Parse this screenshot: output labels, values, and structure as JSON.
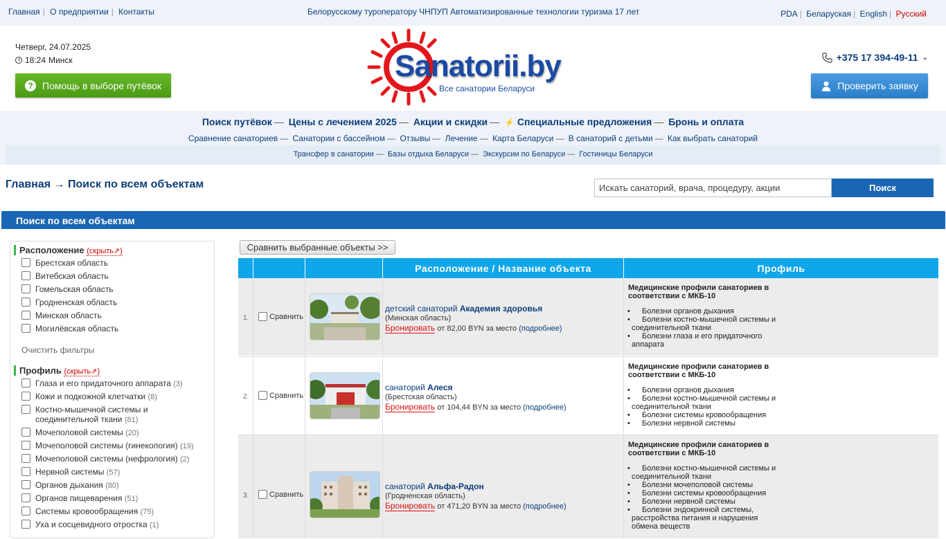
{
  "topbar": {
    "nav": [
      "Главная",
      "О предприятии",
      "Контакты"
    ],
    "tagline": "Белорусскому туроператору ЧНПУП Автоматизированные технологии туризма 17 лет",
    "langs": [
      "PDA",
      "Беларуская",
      "English",
      "Русский"
    ]
  },
  "header": {
    "date": "Четверг, 24.07.2025",
    "time": "18:24",
    "city": "Минск",
    "help_label": "Помощь в выборе путёвок",
    "logo_text": "Sanatorii.by",
    "logo_sub": "Все санатории Беларуси",
    "phone": "+375 17 394-49-11",
    "check_label": "Проверить заявку"
  },
  "menu": {
    "main": [
      "Поиск путёвок",
      "Цены с лечением 2025",
      "Акции и скидки",
      "Специальные предложения",
      "Бронь и оплата"
    ],
    "secondary": [
      "Сравнение санаториев",
      "Санатории с бассейном",
      "Отзывы",
      "Лечение",
      "Карта Беларуси",
      "В санаторий с детьми",
      "Как выбрать санаторий"
    ],
    "tertiary": [
      "Трансфер в санатории",
      "Базы отдыха Беларуси",
      "Экскурсии по Беларуси",
      "Гостиницы Беларуси"
    ]
  },
  "breadcrumb": {
    "home": "Главная",
    "arrow": "→",
    "current": "Поиск по всем объектам"
  },
  "search": {
    "placeholder": "Искать санаторий, врача, процедуру, акции",
    "button": "Поиск"
  },
  "section_title": "Поиск по всем объектам",
  "filters": {
    "location_title": "Расположение",
    "hide": "(скрыть",
    "regions": [
      "Брестская область",
      "Витебская область",
      "Гомельская область",
      "Гродненская область",
      "Минская область",
      "Могилёвская область"
    ],
    "clear": "Очистить фильтры",
    "profile_title": "Профиль",
    "profiles": [
      {
        "label": "Глаза и его придаточного аппарата",
        "count": "(3)"
      },
      {
        "label": "Кожи и подкожной клетчатки",
        "count": "(8)"
      },
      {
        "label": "Костно-мышечной системы и соединительной ткани",
        "count": "(81)"
      },
      {
        "label": "Мочеполовой системы",
        "count": "(20)"
      },
      {
        "label": "Мочеполовой системы (гинекология)",
        "count": "(19)"
      },
      {
        "label": "Мочеполовой системы (нефрология)",
        "count": "(2)"
      },
      {
        "label": "Нервной системы",
        "count": "(57)"
      },
      {
        "label": "Органов дыхания",
        "count": "(80)"
      },
      {
        "label": "Органов пищеварения",
        "count": "(51)"
      },
      {
        "label": "Системы кровообращения",
        "count": "(75)"
      },
      {
        "label": "Уха и сосцевидного отростка",
        "count": "(1)"
      }
    ]
  },
  "compare_button": "Сравнить выбранные объекты >>",
  "table": {
    "col_location": "Расположение / Название объекта",
    "col_profile": "Профиль",
    "compare": "Сравнить",
    "book": "Бронировать",
    "price_from": "от",
    "per_place": "за место",
    "more": "(подробнее)",
    "profile_heading": "Медицинские профили санаториев в соответствии с МКБ-10",
    "rows": [
      {
        "num": "1.",
        "type": "детский санаторий",
        "name": "Академия здоровья",
        "region": "(Минская область)",
        "price": "82,00",
        "currency": "BYN",
        "profiles": [
          "Болезни органов дыхания",
          "Болезни костно-мышечной системы и соединительной ткани",
          "Болезни глаза и его придаточного аппарата"
        ]
      },
      {
        "num": "2.",
        "type": "санаторий",
        "name": "Алеся",
        "region": "(Брестская область)",
        "price": "104,44",
        "currency": "BYN",
        "profiles": [
          "Болезни органов дыхания",
          "Болезни костно-мышечной системы и соединительной ткани",
          "Болезни системы кровообращения",
          "Болезни нервной системы"
        ]
      },
      {
        "num": "3.",
        "type": "санаторий",
        "name": "Альфа-Радон",
        "region": "(Гродненская область)",
        "price": "471,20",
        "currency": "BYN",
        "profiles": [
          "Болезни костно-мышечной системы и соединительной ткани",
          "Болезни мочеполовой системы",
          "Болезни системы кровообращения",
          "Болезни нервной системы",
          "Болезни эндокринной системы, расстройства питания и нарушения обмена веществ"
        ]
      }
    ]
  },
  "colors": {
    "brand_blue": "#1a66b5",
    "table_head": "#0fa6ea",
    "green": "#4a9a14",
    "red": "#c00"
  }
}
